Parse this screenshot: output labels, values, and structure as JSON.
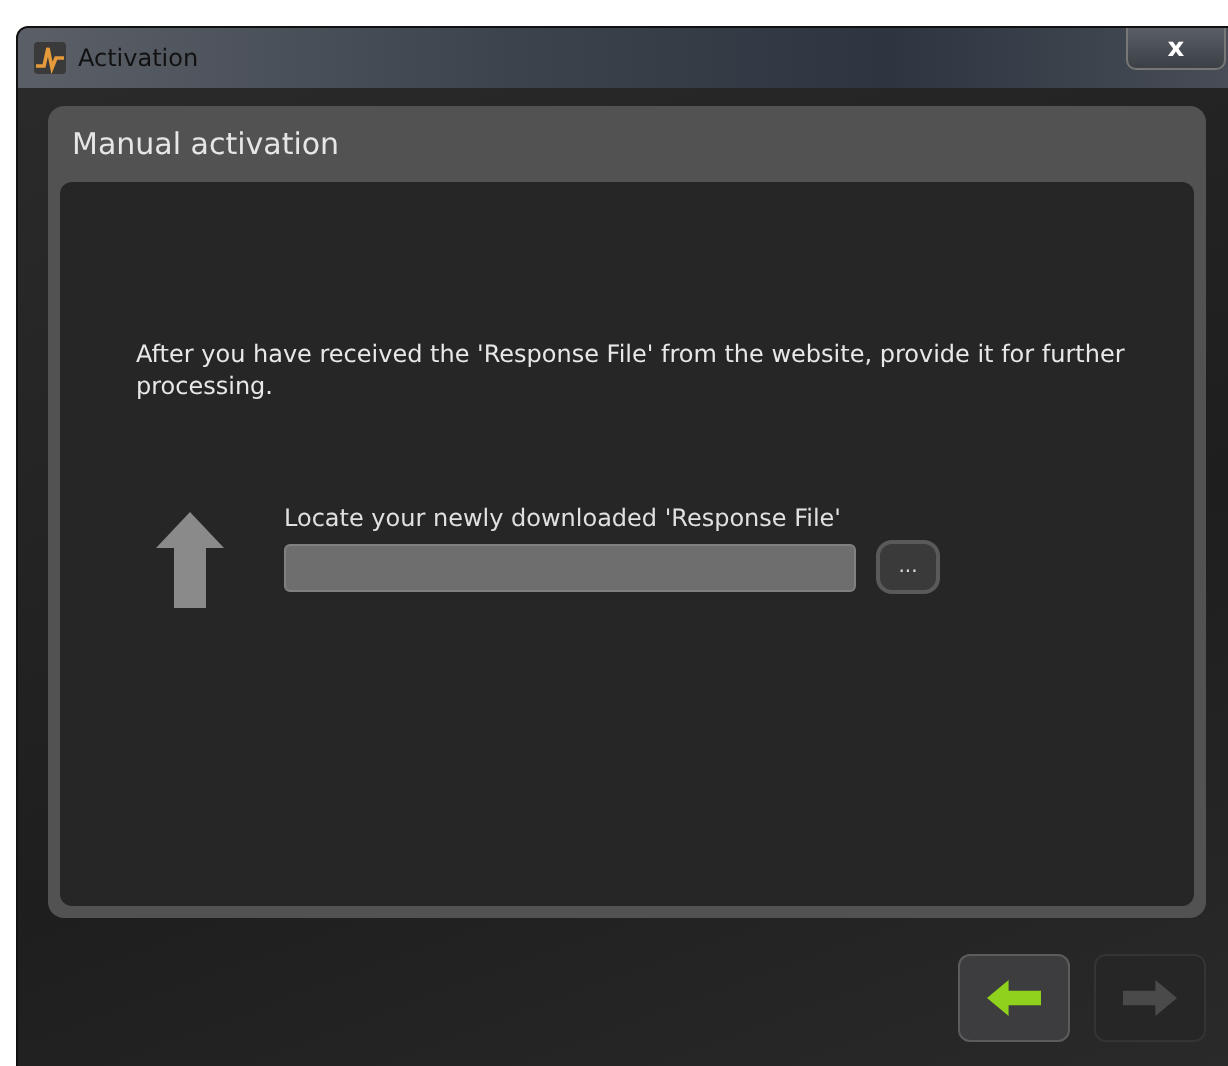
{
  "window": {
    "title": "Activation",
    "close": "x"
  },
  "panel": {
    "title": "Manual activation",
    "instruction": "After you have received the 'Response File' from the website, provide it for further processing.",
    "file_label": "Locate your newly downloaded 'Response File'",
    "browse": "..."
  },
  "nav": {
    "back_disabled": false,
    "next_disabled": true
  }
}
